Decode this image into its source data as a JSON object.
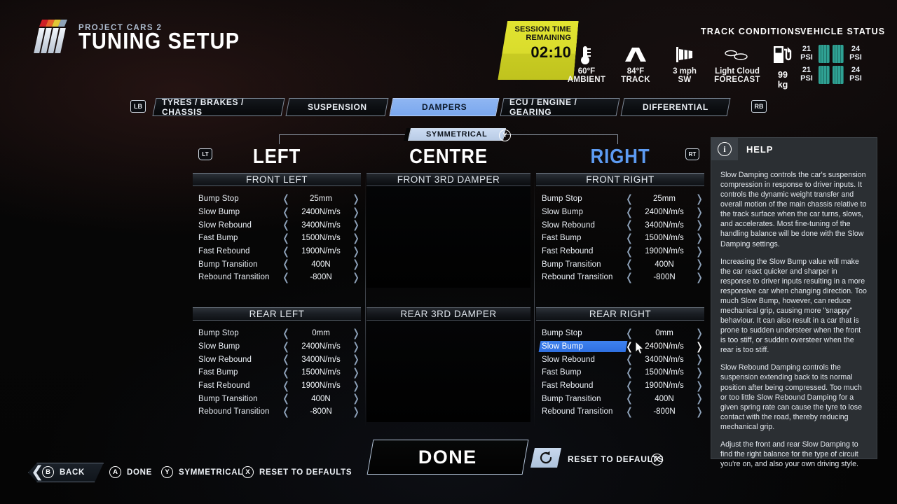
{
  "header": {
    "brand": "PROJECT CARS 2",
    "title": "TUNING SETUP",
    "session": {
      "line1": "SESSION TIME",
      "line2": "REMAINING",
      "time": "02:10"
    },
    "conditions": {
      "ambient": {
        "value": "60°F",
        "label": "AMBIENT",
        "icon": "thermometer-icon"
      },
      "track": {
        "value": "84°F",
        "label": "TRACK",
        "icon": "track-icon"
      },
      "wind": {
        "value": "3 mph",
        "label": "SW",
        "icon": "windsock-icon"
      },
      "forecast": {
        "value": "Light Cloud",
        "label": "FORECAST",
        "icon": "cloud-icon"
      }
    },
    "track_conditions_caption": "TRACK CONDITIONS",
    "vehicle_status_caption": "VEHICLE STATUS",
    "fuel": {
      "value": "99",
      "unit": "kg",
      "icon": "fuel-pump-icon"
    },
    "tyres": [
      {
        "psi": "21",
        "unit": "PSI"
      },
      {
        "psi": "24",
        "unit": "PSI"
      },
      {
        "psi": "21",
        "unit": "PSI"
      },
      {
        "psi": "24",
        "unit": "PSI"
      }
    ]
  },
  "tabs": {
    "left_bumper": "LB",
    "right_bumper": "RB",
    "items": [
      {
        "label": "TYRES / BRAKES / CHASSIS",
        "active": false
      },
      {
        "label": "SUSPENSION",
        "active": false
      },
      {
        "label": "DAMPERS",
        "active": true
      },
      {
        "label": "ECU / ENGINE / GEARING",
        "active": false
      },
      {
        "label": "DIFFERENTIAL",
        "active": false
      }
    ]
  },
  "columns": {
    "symmetrical_label": "SYMMETRICAL",
    "symmetrical_button": "Y",
    "left_trigger": "LT",
    "right_trigger": "RT",
    "left": "LEFT",
    "centre": "CENTRE",
    "right": "RIGHT"
  },
  "panels": {
    "front_left": {
      "title": "FRONT LEFT",
      "rows": [
        {
          "label": "Bump Stop",
          "value": "25mm"
        },
        {
          "label": "Slow Bump",
          "value": "2400N/m/s"
        },
        {
          "label": "Slow Rebound",
          "value": "3400N/m/s"
        },
        {
          "label": "Fast Bump",
          "value": "1500N/m/s"
        },
        {
          "label": "Fast Rebound",
          "value": "1900N/m/s"
        },
        {
          "label": "Bump Transition",
          "value": "400N"
        },
        {
          "label": "Rebound Transition",
          "value": "-800N"
        }
      ]
    },
    "rear_left": {
      "title": "REAR LEFT",
      "rows": [
        {
          "label": "Bump Stop",
          "value": "0mm"
        },
        {
          "label": "Slow Bump",
          "value": "2400N/m/s"
        },
        {
          "label": "Slow Rebound",
          "value": "3400N/m/s"
        },
        {
          "label": "Fast Bump",
          "value": "1500N/m/s"
        },
        {
          "label": "Fast Rebound",
          "value": "1900N/m/s"
        },
        {
          "label": "Bump Transition",
          "value": "400N"
        },
        {
          "label": "Rebound Transition",
          "value": "-800N"
        }
      ]
    },
    "front_right": {
      "title": "FRONT RIGHT",
      "rows": [
        {
          "label": "Bump Stop",
          "value": "25mm"
        },
        {
          "label": "Slow Bump",
          "value": "2400N/m/s"
        },
        {
          "label": "Slow Rebound",
          "value": "3400N/m/s"
        },
        {
          "label": "Fast Bump",
          "value": "1500N/m/s"
        },
        {
          "label": "Fast Rebound",
          "value": "1900N/m/s"
        },
        {
          "label": "Bump Transition",
          "value": "400N"
        },
        {
          "label": "Rebound Transition",
          "value": "-800N"
        }
      ]
    },
    "rear_right": {
      "title": "REAR RIGHT",
      "selected_row": 1,
      "rows": [
        {
          "label": "Bump Stop",
          "value": "0mm"
        },
        {
          "label": "Slow Bump",
          "value": "2400N/m/s"
        },
        {
          "label": "Slow Rebound",
          "value": "3400N/m/s"
        },
        {
          "label": "Fast Bump",
          "value": "1500N/m/s"
        },
        {
          "label": "Fast Rebound",
          "value": "1900N/m/s"
        },
        {
          "label": "Bump Transition",
          "value": "400N"
        },
        {
          "label": "Rebound Transition",
          "value": "-800N"
        }
      ]
    },
    "front_third": {
      "title": "FRONT 3RD DAMPER"
    },
    "rear_third": {
      "title": "REAR 3RD DAMPER"
    }
  },
  "help": {
    "title": "HELP",
    "icon": "info-icon",
    "paragraphs": [
      "Slow Damping controls the car's suspension compression in response to driver inputs. It controls the dynamic weight transfer and overall motion of the main chassis relative to the track surface when the car turns, slows, and accelerates. Most fine-tuning of the handling balance will be done with the Slow Damping settings.",
      "Increasing the Slow Bump value will make the car react quicker and sharper in response to driver inputs resulting in a more responsive car when changing direction. Too much Slow Bump, however, can reduce mechanical grip, causing more \"snappy\" behaviour. It can also result in a car that is prone to sudden understeer when the front is too stiff, or sudden oversteer when the rear is too stiff.",
      "Slow Rebound Damping controls the suspension extending back to its normal position after being compressed. Too much or too little Slow Rebound Damping for a given spring rate can cause the tyre to lose contact with the road, thereby reducing mechanical grip.",
      "Adjust the front and rear Slow Damping to find the right balance for the type of circuit you're on, and also your own driving style."
    ]
  },
  "footer": {
    "done_button": "DONE",
    "reset_label": "RESET TO DEFAULTS",
    "reset_button": "X",
    "reset_icon": "reset-arrow-icon",
    "prompts": [
      {
        "button": "B",
        "label": "BACK"
      },
      {
        "button": "A",
        "label": "DONE"
      },
      {
        "button": "Y",
        "label": "SYMMETRICAL"
      },
      {
        "button": "X",
        "label": "RESET TO DEFAULTS"
      }
    ]
  },
  "colors": {
    "accent_blue": "#5d9bf2",
    "selection_blue": "#3f82ef",
    "session_yellow": "#d9dc2c",
    "tyre_teal": "#2fa193"
  }
}
